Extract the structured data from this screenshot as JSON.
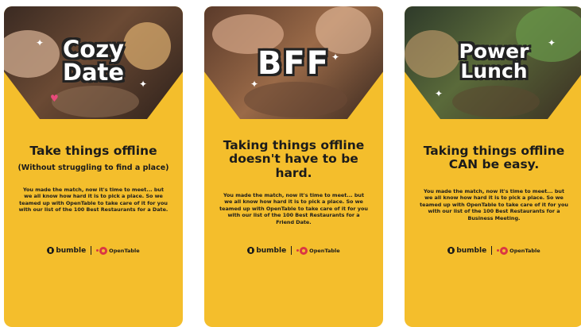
{
  "cards": [
    {
      "badge_line1": "Cozy",
      "badge_line2": "Date",
      "heading": "Take things offline",
      "subheading": "(Without struggling to find a place)",
      "body": "You made the match, now it's time to meet... but we all know how hard it is to pick a place. So we teamed up with OpenTable to take care of it for you with our list of the 100 Best Restaurants for a Date."
    },
    {
      "badge_line1": "BFF",
      "heading": "Taking things offline doesn't have to be hard.",
      "body": "You made the match, now it's time to meet... but we all know how hard it is to pick a place. So we teamed up with OpenTable to take care of it for you with our list of the 100 Best Restaurants for a Friend Date."
    },
    {
      "badge_line1": "Power",
      "badge_line2": "Lunch",
      "heading": "Taking things offline CAN be easy.",
      "body": "You made the match, now it's time to meet... but we all know how hard it is to pick a place. So we teamed up with OpenTable to take care of it for you with our list of the 100 Best Restaurants for a Business Meeting."
    }
  ],
  "logos": {
    "bumble": "bumble",
    "opentable": "OpenTable"
  },
  "colors": {
    "card_bg": "#F4BE2C",
    "opentable_red": "#DA3743",
    "text": "#1b1b1b"
  },
  "icons": [
    "bumble-bee-icon",
    "opentable-dot-icon",
    "sparkle-icon"
  ]
}
